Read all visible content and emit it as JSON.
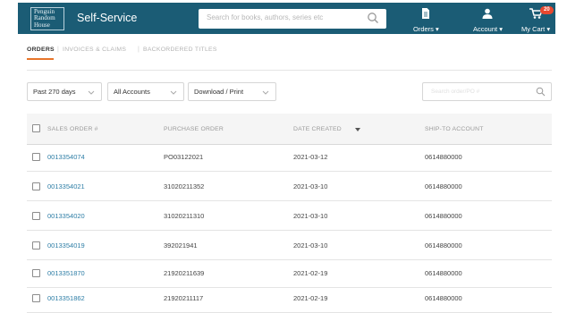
{
  "header": {
    "logo_lines": [
      "Penguin",
      "Random",
      "House"
    ],
    "app_title": "Self-Service",
    "search_placeholder": "Search for books, authors, series etc",
    "nav": {
      "orders": "Orders",
      "account": "Account",
      "cart": "My Cart",
      "cart_count": "20"
    },
    "bg_color": "#1b5c75"
  },
  "tabs": {
    "orders": "ORDERS",
    "invoices": "INVOICES & CLAIMS",
    "backordered": "BACKORDERED TITLES",
    "separator": "|",
    "active_color": "#e8752a"
  },
  "filters": {
    "days": "Past 270 days",
    "accounts": "All Accounts",
    "download": "Download / Print",
    "filter_placeholder": "Search order/PO #"
  },
  "table": {
    "columns": [
      "SALES ORDER #",
      "PURCHASE ORDER",
      "DATE CREATED",
      "SHIP-TO ACCOUNT"
    ],
    "sorted_column": "DATE CREATED",
    "rows": [
      [
        "0013354074",
        "PO03122021",
        "2021-03-12",
        "0614880000"
      ],
      [
        "0013354021",
        "31020211352",
        "2021-03-10",
        "0614880000"
      ],
      [
        "0013354020",
        "31020211310",
        "2021-03-10",
        "0614880000"
      ],
      [
        "0013354019",
        "392021941",
        "2021-03-10",
        "0614880000"
      ],
      [
        "0013351870",
        "21920211639",
        "2021-02-19",
        "0614880000"
      ],
      [
        "0013351862",
        "21920211117",
        "2021-02-19",
        "0614880000"
      ]
    ],
    "link_color": "#2e7ea6"
  },
  "icons": {
    "search": "search-icon",
    "orders": "document-icon",
    "account": "user-icon",
    "cart": "cart-icon",
    "dropdown": "chevron-down-icon",
    "sort": "sort-down-icon"
  }
}
